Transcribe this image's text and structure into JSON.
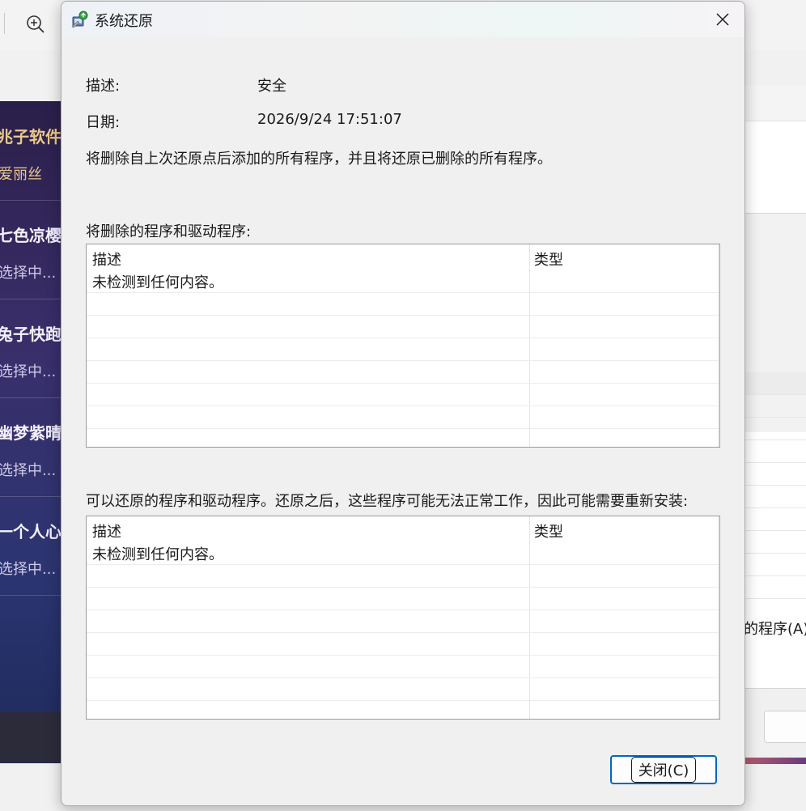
{
  "background": {
    "left_items": [
      {
        "title": "兆子软件",
        "subtitle": "爱丽丝"
      },
      {
        "title": "七色凉樱",
        "subtitle": "选择中..."
      },
      {
        "title": "兔子快跑",
        "subtitle": "选择中..."
      },
      {
        "title": "幽梦紫晴",
        "subtitle": "选择中..."
      },
      {
        "title": "一个人心",
        "subtitle": "选择中..."
      }
    ],
    "right_program_label": "的程序(A)"
  },
  "dialog": {
    "title": "系统还原",
    "description_label": "描述:",
    "description_value": "安全",
    "date_label": "日期:",
    "date_value": "2026/9/24 17:51:07",
    "summary": "将删除自上次还原点后添加的所有程序，并且将还原已删除的所有程序。",
    "delete_section": {
      "label": "将删除的程序和驱动程序:",
      "columns": [
        "描述",
        "类型"
      ],
      "rows": [
        {
          "description": "未检测到任何内容。",
          "type": ""
        }
      ]
    },
    "restore_section": {
      "label": "可以还原的程序和驱动程序。还原之后，这些程序可能无法正常工作，因此可能需要重新安装:",
      "columns": [
        "描述",
        "类型"
      ],
      "rows": [
        {
          "description": "未检测到任何内容。",
          "type": ""
        }
      ]
    },
    "close_button_label": "关闭(C)"
  }
}
